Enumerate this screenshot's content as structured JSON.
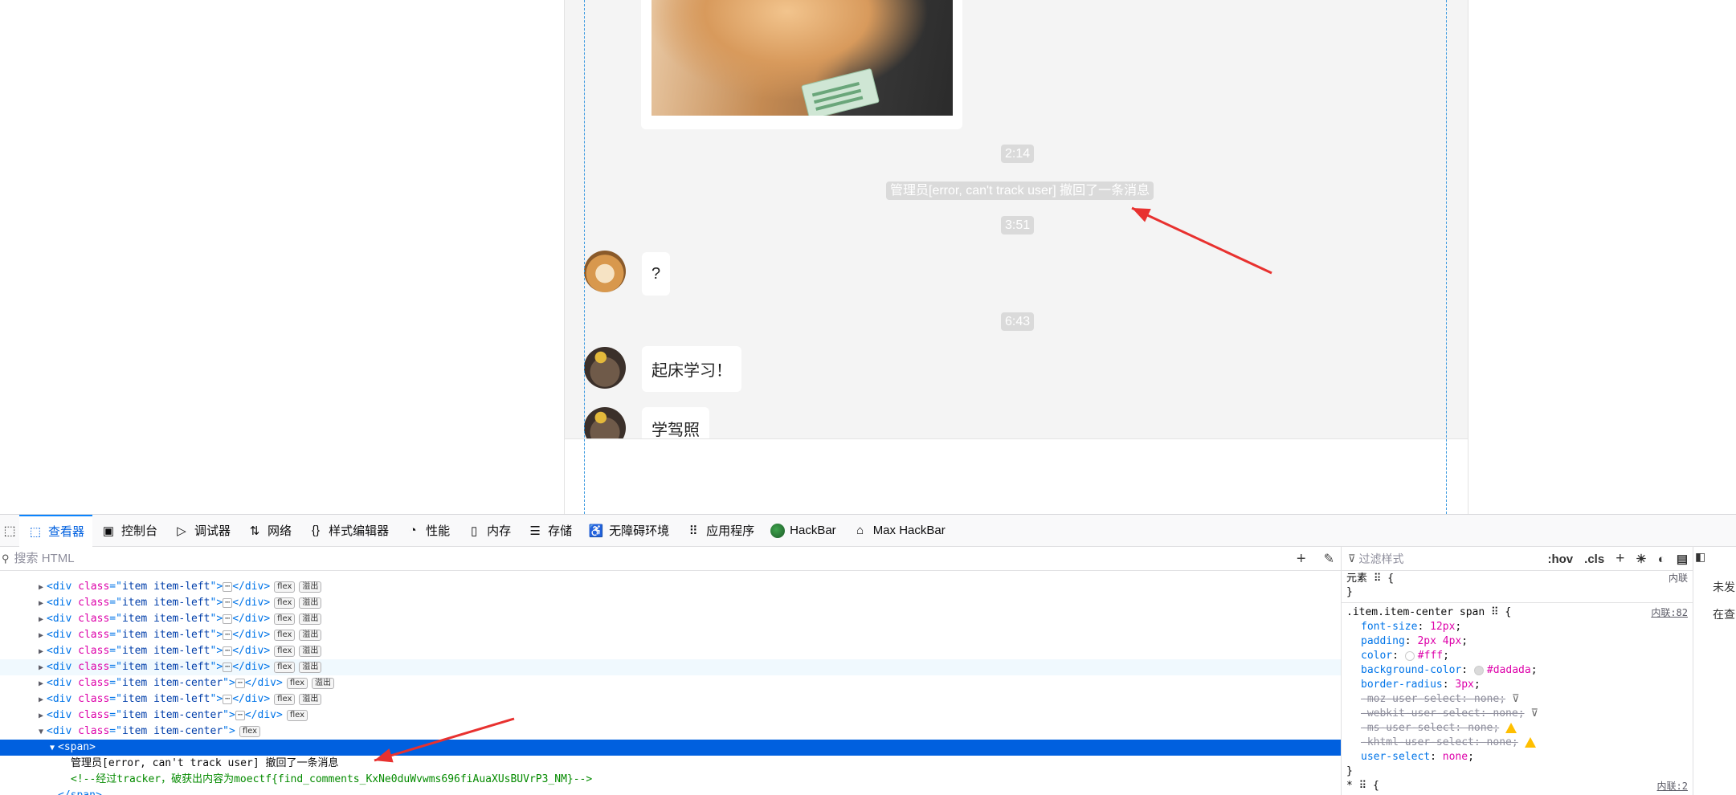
{
  "chat": {
    "times": [
      "2:14",
      "3:51",
      "6:43"
    ],
    "system_message": "管理员[error, can't track user] 撤回了一条消息",
    "messages": [
      "?",
      "起床学习！",
      "学驾照"
    ],
    "image_alt": "shiba-with-card"
  },
  "devtools": {
    "tabs": [
      {
        "label": "查看器",
        "icon": "inspector-icon",
        "active": true
      },
      {
        "label": "控制台",
        "icon": "console-icon"
      },
      {
        "label": "调试器",
        "icon": "debugger-icon"
      },
      {
        "label": "网络",
        "icon": "network-icon"
      },
      {
        "label": "样式编辑器",
        "icon": "style-editor-icon"
      },
      {
        "label": "性能",
        "icon": "performance-icon"
      },
      {
        "label": "内存",
        "icon": "memory-icon"
      },
      {
        "label": "存储",
        "icon": "storage-icon"
      },
      {
        "label": "无障碍环境",
        "icon": "accessibility-icon"
      },
      {
        "label": "应用程序",
        "icon": "application-icon"
      },
      {
        "label": "HackBar",
        "icon": "hackbar-icon"
      },
      {
        "label": "Max HackBar",
        "icon": "max-hackbar-icon"
      }
    ],
    "search_placeholder": "搜索 HTML",
    "tree": {
      "tag_div": "div",
      "attr_class": "class",
      "items": [
        {
          "cls": "item item-left",
          "badges": [
            "flex",
            "溢出"
          ]
        },
        {
          "cls": "item item-left",
          "badges": [
            "flex",
            "溢出"
          ]
        },
        {
          "cls": "item item-left",
          "badges": [
            "flex",
            "溢出"
          ]
        },
        {
          "cls": "item item-left",
          "badges": [
            "flex",
            "溢出"
          ]
        },
        {
          "cls": "item item-left",
          "badges": [
            "flex",
            "溢出"
          ]
        },
        {
          "cls": "item item-left",
          "badges": [
            "flex",
            "溢出"
          ]
        },
        {
          "cls": "item item-center",
          "badges": [
            "flex",
            "溢出"
          ]
        },
        {
          "cls": "item item-left",
          "badges": [
            "flex",
            "溢出"
          ]
        },
        {
          "cls": "item item-center",
          "badges": [
            "flex"
          ]
        }
      ],
      "open_item": {
        "cls": "item item-center",
        "badges": [
          "flex"
        ]
      },
      "span_tag": "span",
      "text_node": "管理员[error, can't track user] 撤回了一条消息",
      "comment": "<!--经过tracker，破获出内容为moectf{find_comments_KxNe0duWvwms696fiAuaXUsBUVrP3_NM}-->",
      "closing_span": "</span>"
    },
    "rules": {
      "filter_placeholder": "过滤样式",
      "hov": ":hov",
      "cls": ".cls",
      "element_label": "元素",
      "inline_label": "内联",
      "rule_selector": ".item.item-center span",
      "rule_source": "内联:82",
      "props": [
        {
          "name": "font-size",
          "value": "12px"
        },
        {
          "name": "padding",
          "value": "2px 4px"
        },
        {
          "name": "color",
          "value": "#fff",
          "swatch": "#ffffff"
        },
        {
          "name": "background-color",
          "value": "#dadada",
          "swatch": "#dadada"
        },
        {
          "name": "border-radius",
          "value": "3px"
        }
      ],
      "struck": [
        {
          "name": "-moz-user-select",
          "value": "none"
        },
        {
          "name": "-webkit-user-select",
          "value": "none"
        },
        {
          "name": "-ms-user-select",
          "value": "none"
        },
        {
          "name": "-khtml-user-select",
          "value": "none"
        }
      ],
      "user_select": {
        "name": "user-select",
        "value": "none"
      },
      "next_source": "内联:2"
    },
    "side_text": [
      "未发",
      "在查"
    ],
    "colors": {
      "accent": "#0060df",
      "arrow": "#e8312f"
    }
  }
}
